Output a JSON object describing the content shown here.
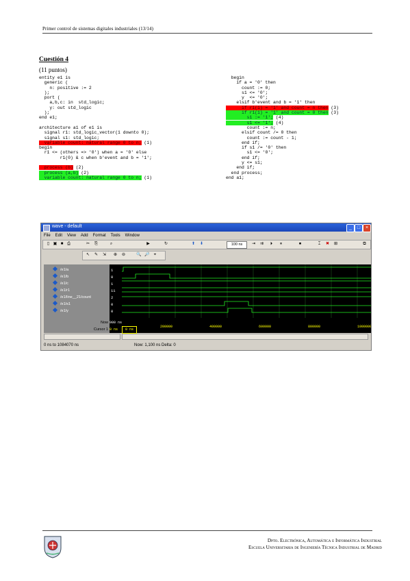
{
  "header": {
    "title": "Primer control de sistemas digitales industriales (13/14)"
  },
  "question": {
    "title": "Cuestión 4",
    "points": "(11 puntos)"
  },
  "code_left": [
    {
      "text": "entity e1 is",
      "hl": ""
    },
    {
      "text": "  generic (",
      "hl": ""
    },
    {
      "text": "    n: positive := 2",
      "hl": ""
    },
    {
      "text": "  );",
      "hl": ""
    },
    {
      "text": "  port (",
      "hl": ""
    },
    {
      "text": "    a,b,c: in  std_logic;",
      "hl": ""
    },
    {
      "text": "    y: out std_logic",
      "hl": ""
    },
    {
      "text": "  );",
      "hl": ""
    },
    {
      "text": "end e1;",
      "hl": ""
    },
    {
      "text": "",
      "hl": ""
    },
    {
      "text": "architecture a1 of e1 is",
      "hl": ""
    },
    {
      "text": "  signal r1: std_logic_vector(1 downto 0);",
      "hl": ""
    },
    {
      "text": "  signal s1: std_logic;",
      "hl": ""
    },
    {
      "text": "  variable count: natural range 0 to n;",
      "hl": "red",
      "note": " (1)"
    },
    {
      "text": "begin",
      "hl": ""
    },
    {
      "text": "  r1 <= (others => '0') when a = '0' else",
      "hl": ""
    },
    {
      "text": "        r1(0) & c when b'event and b = '1';",
      "hl": ""
    },
    {
      "text": "",
      "hl": ""
    },
    {
      "text": "  process (b)",
      "hl": "red",
      "note": " (2)"
    },
    {
      "text": "  process (a,b)",
      "hl": "green",
      "note": " (2)"
    },
    {
      "text": "  variable count: natural range 0 to n;",
      "hl": "green",
      "note": " (1)"
    }
  ],
  "code_right": [
    {
      "text": "  begin",
      "hl": ""
    },
    {
      "text": "    if a = '0' then",
      "hl": ""
    },
    {
      "text": "      count := 0;",
      "hl": ""
    },
    {
      "text": "      s1 <= '0';",
      "hl": ""
    },
    {
      "text": "      y  <= '0';",
      "hl": ""
    },
    {
      "text": "    elsif b'event and b = '1' then",
      "hl": ""
    },
    {
      "text": "      if r1(1) = '1' and count = n then",
      "hl": "red",
      "note": " (3)"
    },
    {
      "text": "      if r1(1) = '1' and count = 0 then",
      "hl": "green",
      "note": " (3)"
    },
    {
      "text": "        s1 := '1';",
      "hl": "green",
      "note": " (4)"
    },
    {
      "text": "        s1 <= '1';",
      "hl": "green",
      "note": " (4)"
    },
    {
      "text": "        count := n;",
      "hl": ""
    },
    {
      "text": "      elsif count /= 0 then",
      "hl": ""
    },
    {
      "text": "        count := count - 1;",
      "hl": ""
    },
    {
      "text": "      end if;",
      "hl": ""
    },
    {
      "text": "      if s1 /= '0' then",
      "hl": ""
    },
    {
      "text": "        s1 <= '0';",
      "hl": ""
    },
    {
      "text": "      end if;",
      "hl": ""
    },
    {
      "text": "      y <= s1;",
      "hl": ""
    },
    {
      "text": "    end if;",
      "hl": ""
    },
    {
      "text": "  end process;",
      "hl": ""
    },
    {
      "text": "end a1;",
      "hl": ""
    }
  ],
  "wave_window": {
    "title": "wave - default",
    "menu": [
      "File",
      "Edit",
      "View",
      "Add",
      "Format",
      "Tools",
      "Window"
    ],
    "signals": [
      {
        "name": "/e1/a",
        "value": "1"
      },
      {
        "name": "/e1/b",
        "value": "0"
      },
      {
        "name": "/e1/c",
        "value": "1"
      },
      {
        "name": "/e1/r1",
        "value": "11"
      },
      {
        "name": "/e1/line__21/count",
        "value": "2"
      },
      {
        "name": "/e1/s1",
        "value": "0"
      },
      {
        "name": "/e1/y",
        "value": "0"
      }
    ],
    "time_labels": [
      "200000",
      "400000",
      "600000",
      "800000",
      "1000000"
    ],
    "now_label": "Now",
    "now_value": "900 ns",
    "cursor_label": "Cursor 1",
    "cursor_value": "0 ns",
    "status_left": "0 ns to 1084070 ns",
    "status_right": "Now: 1,100 ns  Delta: 0",
    "zoom_value": "100 ns"
  },
  "footer": {
    "line1": "Dpto. Electrónica, Automática e Informática Industrial",
    "line2": "Escuela Universitaria de Ingeniería Técnica Industrial de Madrid"
  }
}
